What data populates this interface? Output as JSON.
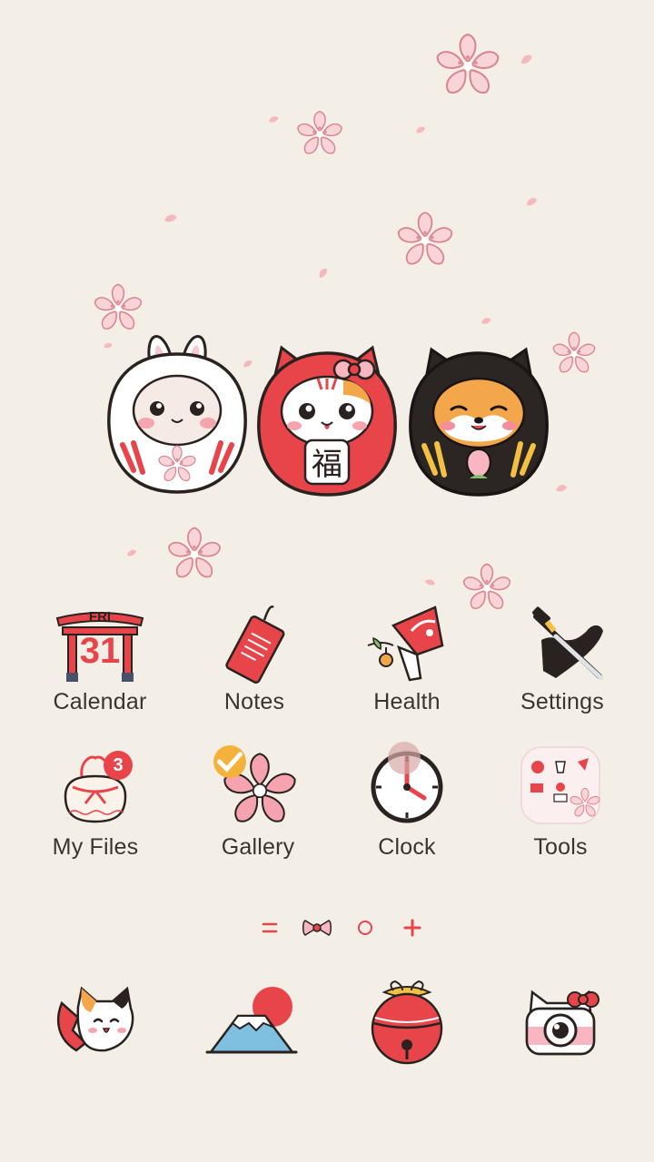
{
  "apps": [
    {
      "label": "Calendar",
      "icon": "torii-calendar-icon",
      "day": "FRI",
      "date": "31"
    },
    {
      "label": "Notes",
      "icon": "tag-notes-icon"
    },
    {
      "label": "Health",
      "icon": "fan-health-icon"
    },
    {
      "label": "Settings",
      "icon": "katana-settings-icon"
    },
    {
      "label": "My Files",
      "icon": "pouch-files-icon",
      "badge": "3"
    },
    {
      "label": "Gallery",
      "icon": "sakura-gallery-icon"
    },
    {
      "label": "Clock",
      "icon": "clock-icon"
    },
    {
      "label": "Tools",
      "icon": "tools-folder-icon"
    }
  ],
  "page_indicator": [
    "menu-lines-icon",
    "bow-current-page-icon",
    "circle-page-icon",
    "plus-page-icon"
  ],
  "dock": [
    {
      "icon": "lucky-cat-phone-icon"
    },
    {
      "icon": "mount-fuji-icon"
    },
    {
      "icon": "red-bell-icon"
    },
    {
      "icon": "cat-camera-icon"
    }
  ],
  "colors": {
    "background": "#f4efe6",
    "accent_red": "#e8454b",
    "label_text": "#3a3330",
    "sakura_pink": "#f7c9cf"
  }
}
